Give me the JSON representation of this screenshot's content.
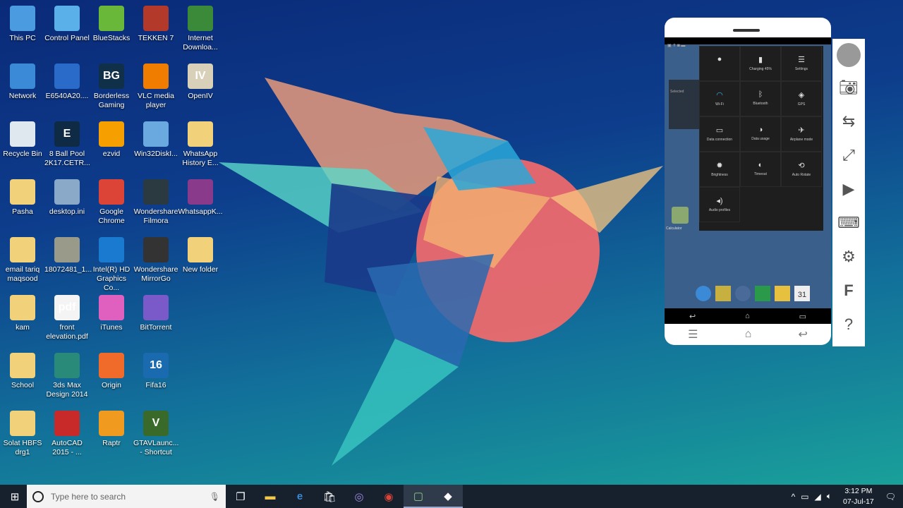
{
  "desktop": {
    "icons": [
      {
        "label": "This PC",
        "icon": "computer-icon",
        "color": "#4a9be0"
      },
      {
        "label": "Control Panel",
        "icon": "control-panel-icon",
        "color": "#5ab0e8"
      },
      {
        "label": "BlueStacks",
        "icon": "bluestacks-icon",
        "color": "#6ab83a"
      },
      {
        "label": "TEKKEN 7",
        "icon": "tekken-icon",
        "color": "#b33a2a"
      },
      {
        "label": "Internet Downloa...",
        "icon": "idm-icon",
        "color": "#3a8a3a"
      },
      {
        "label": "Network",
        "icon": "network-icon",
        "color": "#3a8ad8"
      },
      {
        "label": "E6540A20....",
        "icon": "setup-icon",
        "color": "#2a6ac8"
      },
      {
        "label": "Borderless Gaming",
        "icon": "bg-icon",
        "color": "#10304a",
        "text": "BG"
      },
      {
        "label": "VLC media player",
        "icon": "vlc-icon",
        "color": "#f07d00"
      },
      {
        "label": "OpenIV",
        "icon": "openiv-icon",
        "color": "#d8d0b8",
        "text": "IV"
      },
      {
        "label": "Recycle Bin",
        "icon": "recycle-bin-icon",
        "color": "#dfe8ee"
      },
      {
        "label": "8 Ball Pool 2K17.CETR...",
        "icon": "cheat-engine-icon",
        "color": "#0f2a44",
        "text": "E"
      },
      {
        "label": "ezvid",
        "icon": "ezvid-icon",
        "color": "#f5a000"
      },
      {
        "label": "Win32DiskI...",
        "icon": "disk-imager-icon",
        "color": "#6aa8e0"
      },
      {
        "label": "WhatsApp History E...",
        "icon": "folder-icon",
        "color": "#f1d27a"
      },
      {
        "label": "Pasha",
        "icon": "user-folder-icon",
        "color": "#f1d27a"
      },
      {
        "label": "desktop.ini",
        "icon": "settings-file-icon",
        "color": "#8aa8c8"
      },
      {
        "label": "Google Chrome",
        "icon": "chrome-icon",
        "color": "#db4437"
      },
      {
        "label": "Wondershare Filmora",
        "icon": "filmora-icon",
        "color": "#2a3a40"
      },
      {
        "label": "WhatsappK...",
        "icon": "winrar-icon",
        "color": "#8a3a8a"
      },
      {
        "label": "email tariq maqsood",
        "icon": "folder-icon",
        "color": "#f1d27a"
      },
      {
        "label": "18072481_1...",
        "icon": "image-file-icon",
        "color": "#9a9a8a"
      },
      {
        "label": "Intel(R) HD Graphics Co...",
        "icon": "intel-icon",
        "color": "#1a7ad0"
      },
      {
        "label": "Wondershare MirrorGo",
        "icon": "mirrorgo-icon",
        "color": "#333"
      },
      {
        "label": "New folder",
        "icon": "folder-icon",
        "color": "#f1d27a"
      },
      {
        "label": "kam",
        "icon": "folder-icon",
        "color": "#f1d27a"
      },
      {
        "label": "front elevation.pdf",
        "icon": "pdf-icon",
        "color": "#f4f4f4",
        "text": "pdf"
      },
      {
        "label": "iTunes",
        "icon": "itunes-icon",
        "color": "#e060c0"
      },
      {
        "label": "BitTorrent",
        "icon": "bittorrent-icon",
        "color": "#7a5ac8"
      },
      {
        "label": "",
        "icon": "",
        "color": ""
      },
      {
        "label": "School",
        "icon": "folder-icon",
        "color": "#f1d27a"
      },
      {
        "label": "3ds Max Design 2014",
        "icon": "3dsmax-icon",
        "color": "#2a8a7a"
      },
      {
        "label": "Origin",
        "icon": "origin-icon",
        "color": "#f06a2a"
      },
      {
        "label": "Fifa16",
        "icon": "fifa-icon",
        "color": "#1a6ab0",
        "text": "16"
      },
      {
        "label": "",
        "icon": "",
        "color": ""
      },
      {
        "label": "Solat HBFS drg1",
        "icon": "folder-icon",
        "color": "#f1d27a"
      },
      {
        "label": "AutoCAD 2015 - ...",
        "icon": "autocad-icon",
        "color": "#c82a2a"
      },
      {
        "label": "Raptr",
        "icon": "raptr-icon",
        "color": "#f09a20"
      },
      {
        "label": "GTAVLaunc... - Shortcut",
        "icon": "gta-icon",
        "color": "#3a6a2a",
        "text": "V"
      }
    ]
  },
  "phone": {
    "status_icons": "▣ ✝ ◙ ▬",
    "tiles": [
      {
        "label": "",
        "icon": "brightness-circle-icon"
      },
      {
        "label": "Charging 45%",
        "icon": "battery-icon"
      },
      {
        "label": "Settings",
        "icon": "sliders-icon"
      },
      {
        "label": "Wi-Fi",
        "icon": "wifi-icon"
      },
      {
        "label": "Bluetooth",
        "icon": "bluetooth-icon"
      },
      {
        "label": "GPS",
        "icon": "gps-icon"
      },
      {
        "label": "Data connection",
        "icon": "data-icon"
      },
      {
        "label": "Data usage",
        "icon": "data-usage-icon"
      },
      {
        "label": "Airplane mode",
        "icon": "airplane-icon"
      },
      {
        "label": "Brightness",
        "icon": "sun-icon"
      },
      {
        "label": "Timeout",
        "icon": "timeout-icon"
      },
      {
        "label": "Auto Rotate",
        "icon": "rotate-icon"
      },
      {
        "label": "Audio profiles",
        "icon": "audio-icon"
      }
    ],
    "app_label": "Calculator",
    "side_partial": "Selected",
    "dock_date": "31"
  },
  "taskbar": {
    "search_placeholder": "Type here to search",
    "time": "3:12 PM",
    "date": "07-Jul-17"
  }
}
